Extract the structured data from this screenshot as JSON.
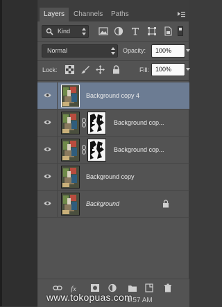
{
  "tabs": [
    {
      "label": "Layers",
      "active": true
    },
    {
      "label": "Channels",
      "active": false
    },
    {
      "label": "Paths",
      "active": false
    }
  ],
  "filter": {
    "kind_label": "Kind",
    "icons": [
      "image-filter-icon",
      "adjustment-filter-icon",
      "type-filter-icon",
      "shape-filter-icon",
      "smart-object-filter-icon"
    ]
  },
  "blend": {
    "mode": "Normal",
    "opacity_label": "Opacity:",
    "opacity_value": "100%"
  },
  "lock": {
    "label": "Lock:",
    "fill_label": "Fill:",
    "fill_value": "100%"
  },
  "layers": [
    {
      "name": "Background copy 4",
      "selected": true,
      "has_mask": false,
      "italic": false,
      "locked": false
    },
    {
      "name": "Background cop...",
      "selected": false,
      "has_mask": true,
      "italic": false,
      "locked": false
    },
    {
      "name": "Background cop...",
      "selected": false,
      "has_mask": true,
      "italic": false,
      "locked": false
    },
    {
      "name": "Background copy",
      "selected": false,
      "has_mask": false,
      "italic": false,
      "locked": false
    },
    {
      "name": "Background",
      "selected": false,
      "has_mask": false,
      "italic": true,
      "locked": true
    }
  ],
  "watermark": "www.tokopuas.com",
  "clock": "1:57 AM",
  "colors": {
    "panel_bg": "#535353",
    "selected_row": "#6c7c93",
    "field_bg": "#fafafa"
  }
}
